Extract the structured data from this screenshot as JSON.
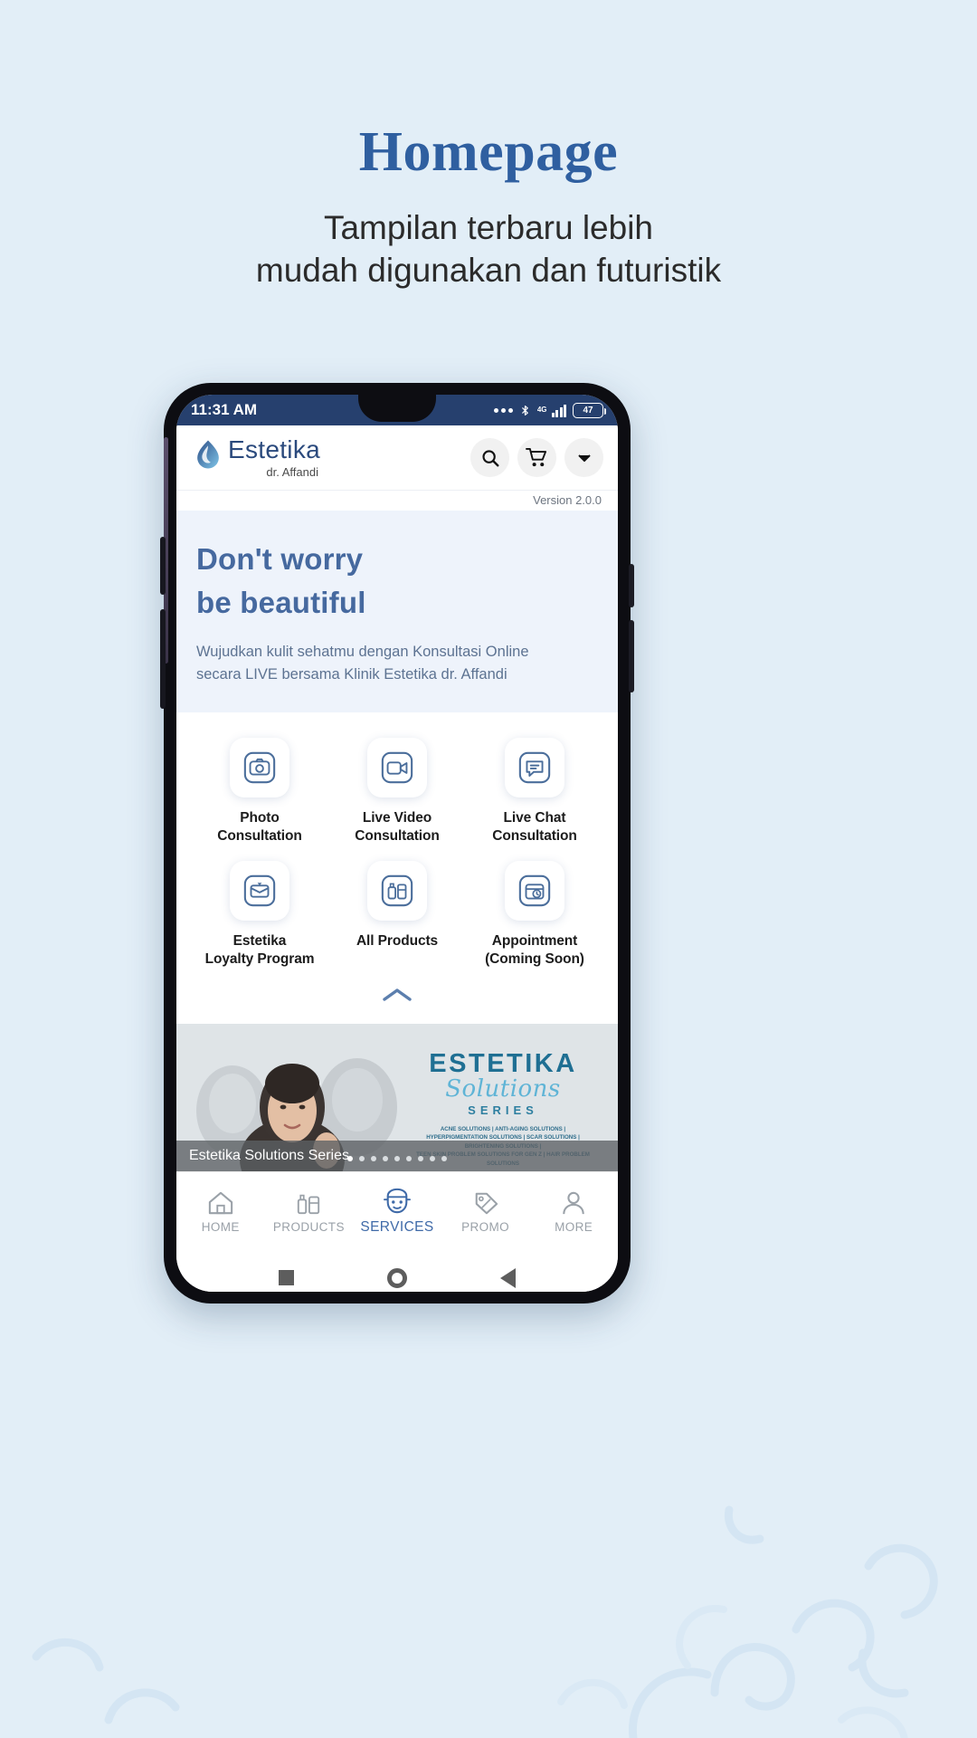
{
  "header": {
    "title": "Homepage",
    "subtitle_line1": "Tampilan terbaru lebih",
    "subtitle_line2": "mudah digunakan dan futuristik",
    "title_color": "#2f5fa0"
  },
  "phone": {
    "statusbar": {
      "time": "11:31 AM",
      "overflow_icon": "more-dots-icon",
      "bluetooth_icon": "bluetooth-icon",
      "network_label": "4G",
      "signal_icon": "signal-bars-icon",
      "battery_level": "47",
      "background": "#26406e"
    },
    "appbar": {
      "brand_name": "Estetika",
      "brand_subtitle": "dr. Affandi",
      "logo_icon": "estetika-droplet-leaf-icon",
      "actions": [
        {
          "name": "search-button",
          "icon": "search-icon"
        },
        {
          "name": "cart-button",
          "icon": "shopping-cart-icon"
        },
        {
          "name": "dropdown-button",
          "icon": "chevron-down-icon"
        }
      ]
    },
    "version": "Version 2.0.0",
    "hero": {
      "headline_line1": "Don't worry",
      "headline_line2": "be beautiful",
      "body_line1": "Wujudkan kulit sehatmu dengan Konsultasi Online",
      "body_line2": "secara LIVE bersama Klinik Estetika dr. Affandi",
      "background": "#eef3fb",
      "headline_color": "#46699f"
    },
    "menu": {
      "items": [
        {
          "id": "photo-consultation",
          "icon": "camera-icon",
          "line1": "Photo",
          "line2": "Consultation"
        },
        {
          "id": "live-video-consultation",
          "icon": "video-camera-icon",
          "line1": "Live Video",
          "line2": "Consultation"
        },
        {
          "id": "live-chat-consultation",
          "icon": "chat-bubble-icon",
          "line1": "Live Chat",
          "line2": "Consultation"
        },
        {
          "id": "estetika-loyalty-program",
          "icon": "loyalty-card-icon",
          "line1": "Estetika",
          "line2": "Loyalty Program"
        },
        {
          "id": "all-products",
          "icon": "products-bottles-icon",
          "line1": "All Products",
          "line2": ""
        },
        {
          "id": "appointment",
          "icon": "calendar-clock-icon",
          "line1": "Appointment",
          "line2": "(Coming Soon)"
        }
      ],
      "collapse_icon": "chevron-up-icon"
    },
    "banner": {
      "brand_top": "ESTETIKA",
      "brand_script": "Solutions",
      "brand_bottom": "SERIES",
      "list_line1": "ACNE SOLUTIONS | ANTI-AGING SOLUTIONS |",
      "list_line2": "HYPERPIGMENTATION SOLUTIONS | SCAR SOLUTIONS | BRIGHTENING SOLUTIONS |",
      "list_line3": "TEEN SKIN PROBLEM SOLUTIONS FOR GEN Z | HAIR PROBLEM SOLUTIONS",
      "caption": "Estetika Solutions Series",
      "dot_count": 9,
      "active_dot": 0
    },
    "bottomnav": {
      "items": [
        {
          "id": "nav-home",
          "label": "HOME",
          "icon": "home-icon",
          "active": false
        },
        {
          "id": "nav-products",
          "label": "PRODUCTS",
          "icon": "products-icon",
          "active": false
        },
        {
          "id": "nav-services",
          "label": "SERVICES",
          "icon": "services-face-icon",
          "active": true
        },
        {
          "id": "nav-promo",
          "label": "PROMO",
          "icon": "promo-tag-icon",
          "active": false
        },
        {
          "id": "nav-more",
          "label": "MORE",
          "icon": "person-icon",
          "active": false
        }
      ],
      "active_color": "#3f6aa8",
      "inactive_color": "#9aa1a8"
    },
    "androidbar": {
      "recents_icon": "square-recents-icon",
      "home_icon": "circle-home-icon",
      "back_icon": "triangle-back-icon"
    }
  }
}
